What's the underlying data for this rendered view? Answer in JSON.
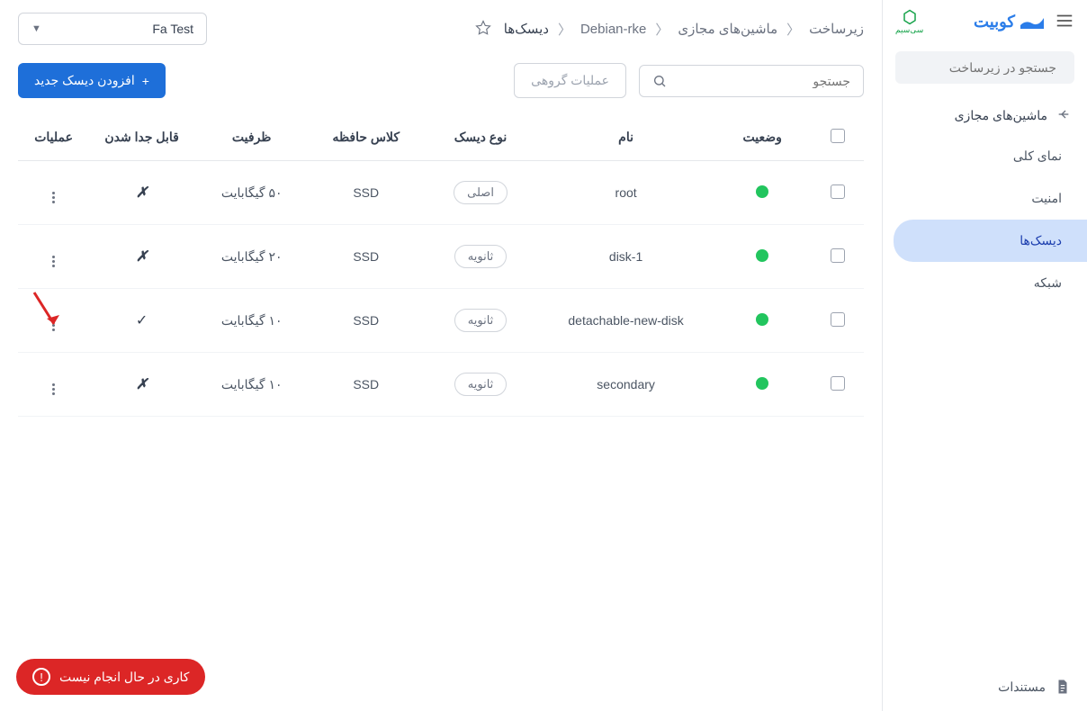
{
  "brand": {
    "name": "کوبیت",
    "secondary": "سی‌سیم"
  },
  "sidebar": {
    "search_placeholder": "جستجو در زیرساخت",
    "section_label": "ماشین‌های مجازی",
    "items": [
      {
        "label": "نمای کلی"
      },
      {
        "label": "امنیت"
      },
      {
        "label": "دیسک‌ها"
      },
      {
        "label": "شبکه"
      }
    ],
    "docs_label": "مستندات"
  },
  "breadcrumb": {
    "items": [
      "زیرساخت",
      "ماشین‌های مجازی",
      "Debian-rke",
      "دیسک‌ها"
    ]
  },
  "project_select": {
    "label": "Fa Test"
  },
  "toolbar": {
    "search_placeholder": "جستجو",
    "group_ops": "عملیات گروهی",
    "add_disk": "افزودن دیسک جدید"
  },
  "table": {
    "headers": {
      "status": "وضعیت",
      "name": "نام",
      "type": "نوع دیسک",
      "class": "کلاس حافظه",
      "capacity": "ظرفیت",
      "detachable": "قابل جدا شدن",
      "actions": "عملیات"
    },
    "rows": [
      {
        "name": "root",
        "type": "اصلی",
        "class": "SSD",
        "capacity": "۵۰ گیگابایت",
        "detachable": false
      },
      {
        "name": "disk-1",
        "type": "ثانویه",
        "class": "SSD",
        "capacity": "۲۰ گیگابایت",
        "detachable": false
      },
      {
        "name": "detachable-new-disk",
        "type": "ثانویه",
        "class": "SSD",
        "capacity": "۱۰ گیگابایت",
        "detachable": true
      },
      {
        "name": "secondary",
        "type": "ثانویه",
        "class": "SSD",
        "capacity": "۱۰ گیگابایت",
        "detachable": false
      }
    ]
  },
  "status_pill": {
    "text": "کاری در حال انجام نیست"
  }
}
